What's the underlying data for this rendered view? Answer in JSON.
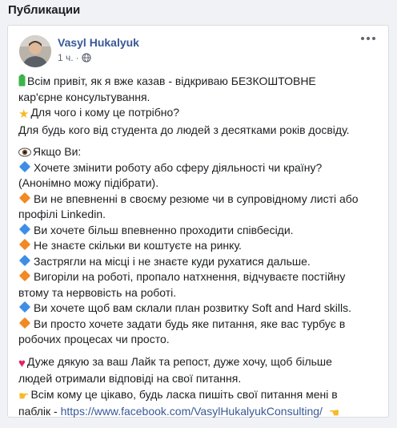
{
  "section": {
    "title": "Публикации"
  },
  "post": {
    "author": "Vasyl Hukalyuk",
    "time": "1 ч.",
    "lines_p1": [
      "Всім привіт, як я вже казав - відкриваю БЕЗКОШТОВНЕ",
      "кар'єрне консультування.",
      "Для чого і кому це потрібно?",
      "Для будь кого від студента до людей з десятками років досвіду."
    ],
    "p2": {
      "intro": "Якщо Ви:",
      "items": [
        [
          "Хочете змінити роботу або сферу діяльності чи країну?",
          "(Анонімно можу підібрати)."
        ],
        [
          "Ви не впевненні в своєму резюме чи в супровідному листі або",
          "профілі Linkedin."
        ],
        [
          "Ви хочете більш впевненно проходити співбесіди."
        ],
        [
          "Не знаєте скільки ви коштуєте на ринку."
        ],
        [
          "Застрягли на місці і не знаєте куди рухатися дальше."
        ],
        [
          "Вигоріли на роботі, пропало натхнення, відчуваєте постійну",
          "втому та нервовість на роботі."
        ],
        [
          "Ви хочете щоб вам склали план розвитку Soft and Hard skills."
        ],
        [
          "Ви просто хочете задати будь яке питання, яке вас турбує в",
          "робочих процесах чи просто."
        ]
      ]
    },
    "lines_p3": [
      "Дуже дякую за ваш Лайк та репост, дуже хочу, щоб більше",
      "людей отримали відповіді на свої питання.",
      "Всім кому це цікаво, будь ласка пишіть свої питання мені в",
      "паблік - "
    ],
    "link": "https://www.facebook.com/VasylHukalyukConsulting/",
    "colors": {
      "link": "#385898",
      "blue_diamond": "#3d8ee6",
      "orange_diamond": "#f08a24"
    }
  }
}
